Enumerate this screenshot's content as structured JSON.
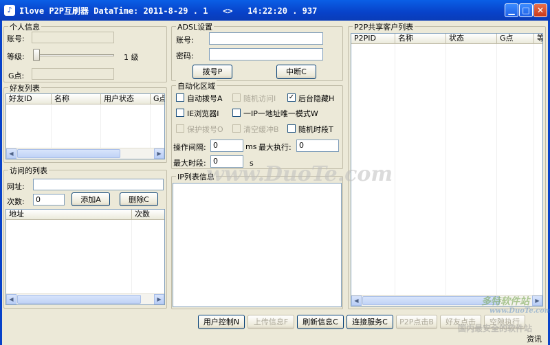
{
  "window": {
    "title": "Ilove P2P互刷器 DataTime: 2011-8-29 . 1   <>   14:22:20 . 937",
    "minimize": "▁",
    "maximize": "□",
    "close": "✕"
  },
  "personal": {
    "legend": "个人信息",
    "account_label": "账号:",
    "level_label": "等级:",
    "level_value": "1 级",
    "level_fraction": 0.0,
    "g_label": "G点:"
  },
  "friends": {
    "legend": "好友列表",
    "columns": [
      "好友ID",
      "名称",
      "用户状态",
      "G点"
    ]
  },
  "visited": {
    "legend": "访问的列表",
    "url_label": "网址:",
    "count_label": "次数:",
    "count_value": "0",
    "add_button": "添加A",
    "delete_button": "删除C",
    "columns": [
      "地址",
      "次数"
    ]
  },
  "adsl": {
    "legend": "ADSL设置",
    "account_label": "账号:",
    "password_label": "密码:",
    "dial_button": "拨号P",
    "disconnect_button": "中断C"
  },
  "automation": {
    "legend": "自动化区域",
    "checkboxes": [
      {
        "label": "自动拨号A",
        "checked": "",
        "enabled": true
      },
      {
        "label": "随机访问I",
        "checked": "",
        "enabled": false
      },
      {
        "label": "后台隐藏H",
        "checked": "✓",
        "enabled": true
      },
      {
        "label": "IE浏览器I",
        "checked": "",
        "enabled": true
      },
      {
        "label": "一IP一地址唯一模式W",
        "checked": "",
        "enabled": true
      },
      {
        "label": "保护拨号O",
        "checked": "",
        "enabled": false
      },
      {
        "label": "清空缓冲B",
        "checked": "",
        "enabled": false
      },
      {
        "label": "随机时段T",
        "checked": "",
        "enabled": true
      }
    ],
    "interval_label": "操作间隔:",
    "interval_value": "0",
    "interval_unit": "ms",
    "max_exec_label": "最大执行:",
    "max_exec_value": "0",
    "max_period_label": "最大时段:",
    "max_period_value": "0",
    "max_period_unit": "s"
  },
  "ip_list": {
    "legend": "IP列表信息"
  },
  "p2p": {
    "legend": "P2P共享客户列表",
    "columns": [
      "P2PID",
      "名称",
      "状态",
      "G点",
      "等"
    ]
  },
  "bottom_buttons": [
    {
      "label": "用户控制N",
      "enabled": true
    },
    {
      "label": "上传信息F",
      "enabled": false
    },
    {
      "label": "刷新信息C",
      "enabled": true
    },
    {
      "label": "连接服务C",
      "enabled": true
    },
    {
      "label": "P2P点击B",
      "enabled": false
    },
    {
      "label": "好友点击",
      "enabled": false
    },
    {
      "label": "空隙执行",
      "enabled": false
    }
  ],
  "status": {
    "info": "资讯"
  },
  "watermarks": {
    "center": "www.DuoTe.com",
    "brand": "多特软件站",
    "brand_url": "www.DuoTe.com",
    "slogan": "国内最安全的软件站"
  }
}
